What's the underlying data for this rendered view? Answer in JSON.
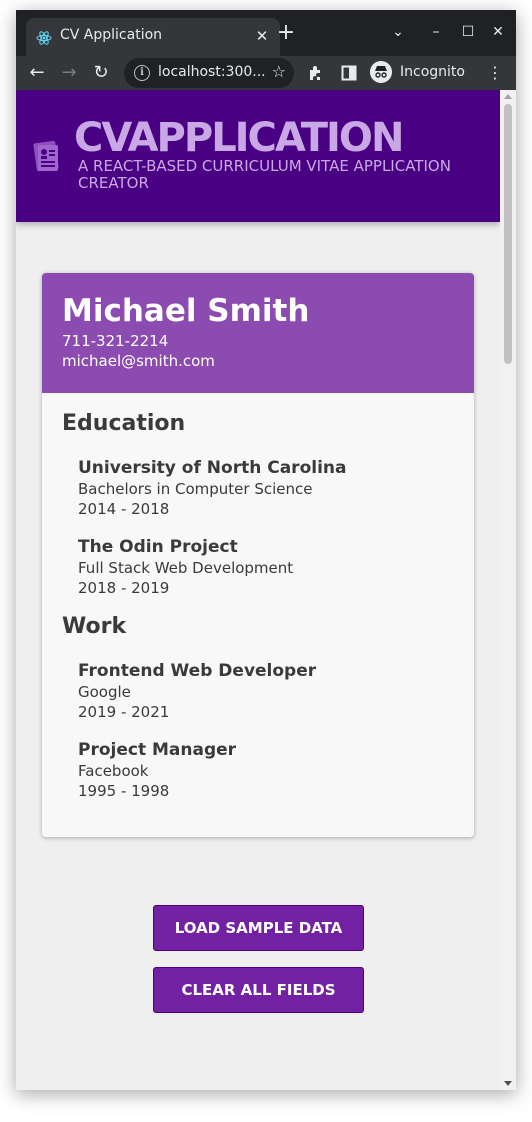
{
  "browser": {
    "tab_title": "CV Application",
    "tab_close_icon": "close-icon",
    "new_tab_icon": "plus-icon",
    "address": "localhost:300...",
    "incognito_label": "Incognito"
  },
  "header": {
    "title": "CVAPPLICATION",
    "subtitle": "A REACT-BASED CURRICULUM VITAE APPLICATION CREATOR",
    "background_color": "#4a0082",
    "title_color": "#c9a8e6"
  },
  "cv": {
    "name": "Michael Smith",
    "phone": "711-321-2214",
    "email": "michael@smith.com",
    "accent_color": "#8b4bb0",
    "education_title": "Education",
    "education": [
      {
        "school": "University of North Carolina",
        "detail": "Bachelors in Computer Science",
        "years": "2014 - 2018"
      },
      {
        "school": "The Odin Project",
        "detail": "Full Stack Web Development",
        "years": "2018 - 2019"
      }
    ],
    "work_title": "Work",
    "work": [
      {
        "position": "Frontend Web Developer",
        "company": "Google",
        "years": "2019 - 2021"
      },
      {
        "position": "Project Manager",
        "company": "Facebook",
        "years": "1995 - 1998"
      }
    ]
  },
  "actions": {
    "load_sample": "LOAD SAMPLE DATA",
    "clear_all": "CLEAR ALL FIELDS",
    "button_color": "#7221a2"
  }
}
